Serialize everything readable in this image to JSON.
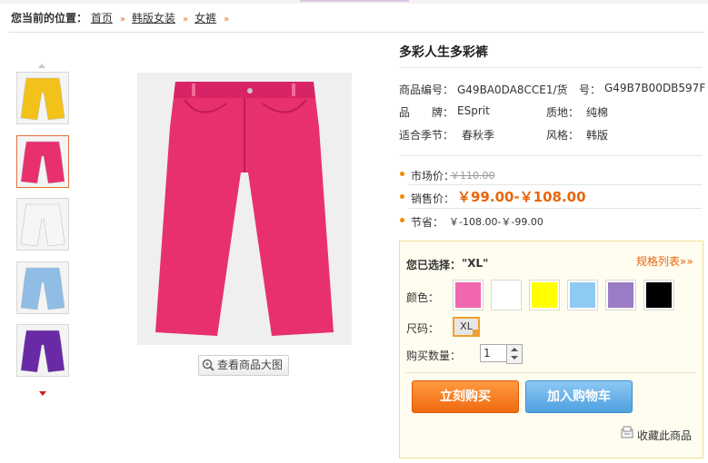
{
  "breadcrumb": {
    "prefix": "您当前的位置：",
    "items": [
      "首页",
      "韩版女装",
      "女裤"
    ],
    "separator": "»"
  },
  "colors": {
    "accent_orange": "#e8650a",
    "selected_red": "#d0001a",
    "main_product": "#e8306f"
  },
  "thumbnails": [
    {
      "name": "yellow-pants",
      "color": "#f2c21a"
    },
    {
      "name": "pink-pants",
      "color": "#e8306f",
      "selected": true
    },
    {
      "name": "white-pants",
      "color": "#f6f6f6"
    },
    {
      "name": "blue-pants",
      "color": "#8fbde6"
    },
    {
      "name": "purple-pants",
      "color": "#6a2aa6"
    }
  ],
  "zoom_button": {
    "label": "查看商品大图",
    "icon": "magnifier-icon"
  },
  "product": {
    "title": "多彩人生多彩裤",
    "code_label": "商品编号：",
    "code_value": "G49BA0DA8CCE1/货",
    "num_label": "号：",
    "num_value": "G49B7B00DB597F",
    "brand_label": "品　　牌：",
    "brand_value": "ESprit",
    "material_label": "质地：",
    "material_value": "纯棉",
    "season_label": "适合季节：",
    "season_value": "春秋季",
    "style_label": "风格：",
    "style_value": "韩版"
  },
  "prices": {
    "market_label": "市场价：",
    "market_value": "￥110.00",
    "sale_label": "销售价：",
    "sale_value": "￥99.00-￥108.00",
    "save_label": "节省：",
    "save_value": "￥-108.00-￥-99.00"
  },
  "selection": {
    "selected_label": "您已选择：",
    "selected_value": "\"XL\"",
    "spec_link": "规格列表»»",
    "color_label": "颜色：",
    "swatches": [
      "#f067b0",
      "#ffffff",
      "#ffff00",
      "#8fcaf2",
      "#9a7cc4",
      "#000000"
    ],
    "size_label": "尺码：",
    "size_value": "XL",
    "qty_label": "购买数量：",
    "qty_value": "1",
    "buy_label": "立刻购买",
    "cart_label": "加入购物车",
    "fav_label": "收藏此商品"
  }
}
